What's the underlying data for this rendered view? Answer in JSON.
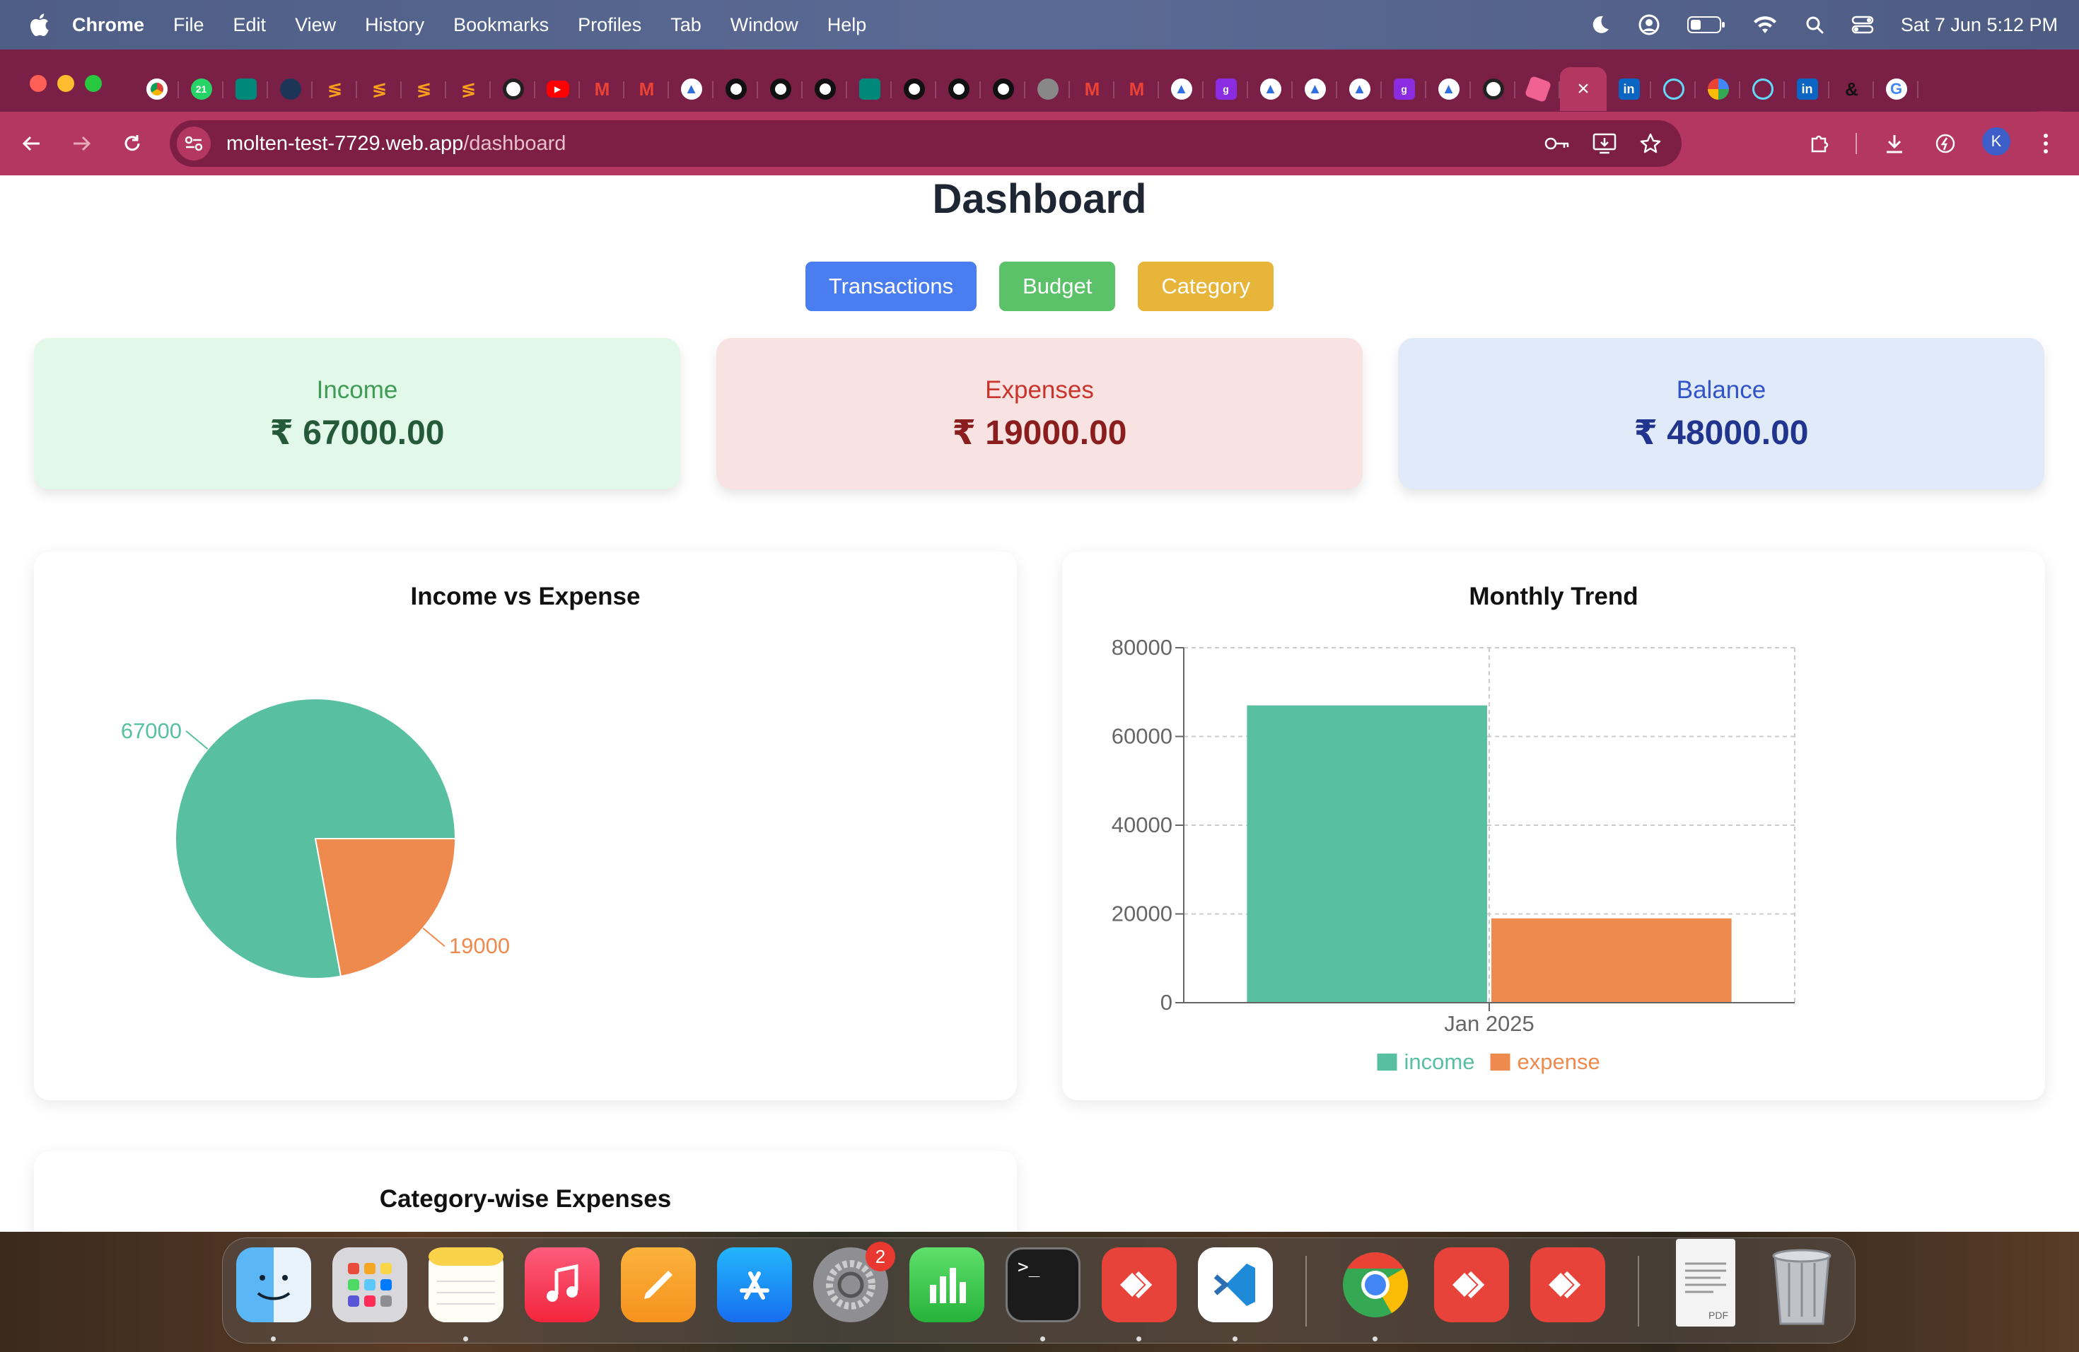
{
  "menubar": {
    "app": "Chrome",
    "items": [
      "File",
      "Edit",
      "View",
      "History",
      "Bookmarks",
      "Profiles",
      "Tab",
      "Window",
      "Help"
    ],
    "clock": "Sat 7 Jun  5:12 PM"
  },
  "tabs": {
    "active_close": "×",
    "new_tab": "+"
  },
  "toolbar": {
    "url_host": "molten-test-7729.web.app",
    "url_path": "/dashboard",
    "profile_initial": "K"
  },
  "dashboard": {
    "title": "Dashboard",
    "buttons": [
      {
        "label": "Transactions",
        "color": "#4a7ef0"
      },
      {
        "label": "Budget",
        "color": "#5cc26a"
      },
      {
        "label": "Category",
        "color": "#e7b53a"
      }
    ],
    "summary": {
      "income": {
        "label": "Income",
        "value": "₹ 67000.00",
        "bg": "#e2f8e8",
        "label_color": "#3e9c55",
        "value_color": "#24593a"
      },
      "expenses": {
        "label": "Expenses",
        "value": "₹ 19000.00",
        "bg": "#f8e2e2",
        "label_color": "#c9342c",
        "value_color": "#8a1d1d"
      },
      "balance": {
        "label": "Balance",
        "value": "₹ 48000.00",
        "bg": "#e1eaf9",
        "label_color": "#3254c9",
        "value_color": "#21358f"
      }
    },
    "pie_panel_title": "Income vs Expense",
    "trend_panel_title": "Monthly Trend",
    "category_panel_title": "Category-wise Expenses"
  },
  "chart_data": [
    {
      "type": "pie",
      "title": "Income vs Expense",
      "labels": [
        "income",
        "expense"
      ],
      "values": [
        67000,
        19000
      ],
      "data_labels": [
        "67000",
        "19000"
      ],
      "colors": [
        "#58c0a0",
        "#ef8a4e"
      ]
    },
    {
      "type": "bar",
      "title": "Monthly Trend",
      "categories": [
        "Jan 2025"
      ],
      "series": [
        {
          "name": "income",
          "values": [
            67000
          ],
          "color": "#58c0a0"
        },
        {
          "name": "expense",
          "values": [
            19000
          ],
          "color": "#ef8a4e"
        }
      ],
      "ylim": [
        0,
        80000
      ],
      "yticks": [
        0,
        20000,
        40000,
        60000,
        80000
      ],
      "grid": true,
      "legend": "bottom-center"
    }
  ],
  "dock": {
    "badge": "2",
    "pdf_label": "PDF",
    "terminal_prompt": ">_"
  }
}
